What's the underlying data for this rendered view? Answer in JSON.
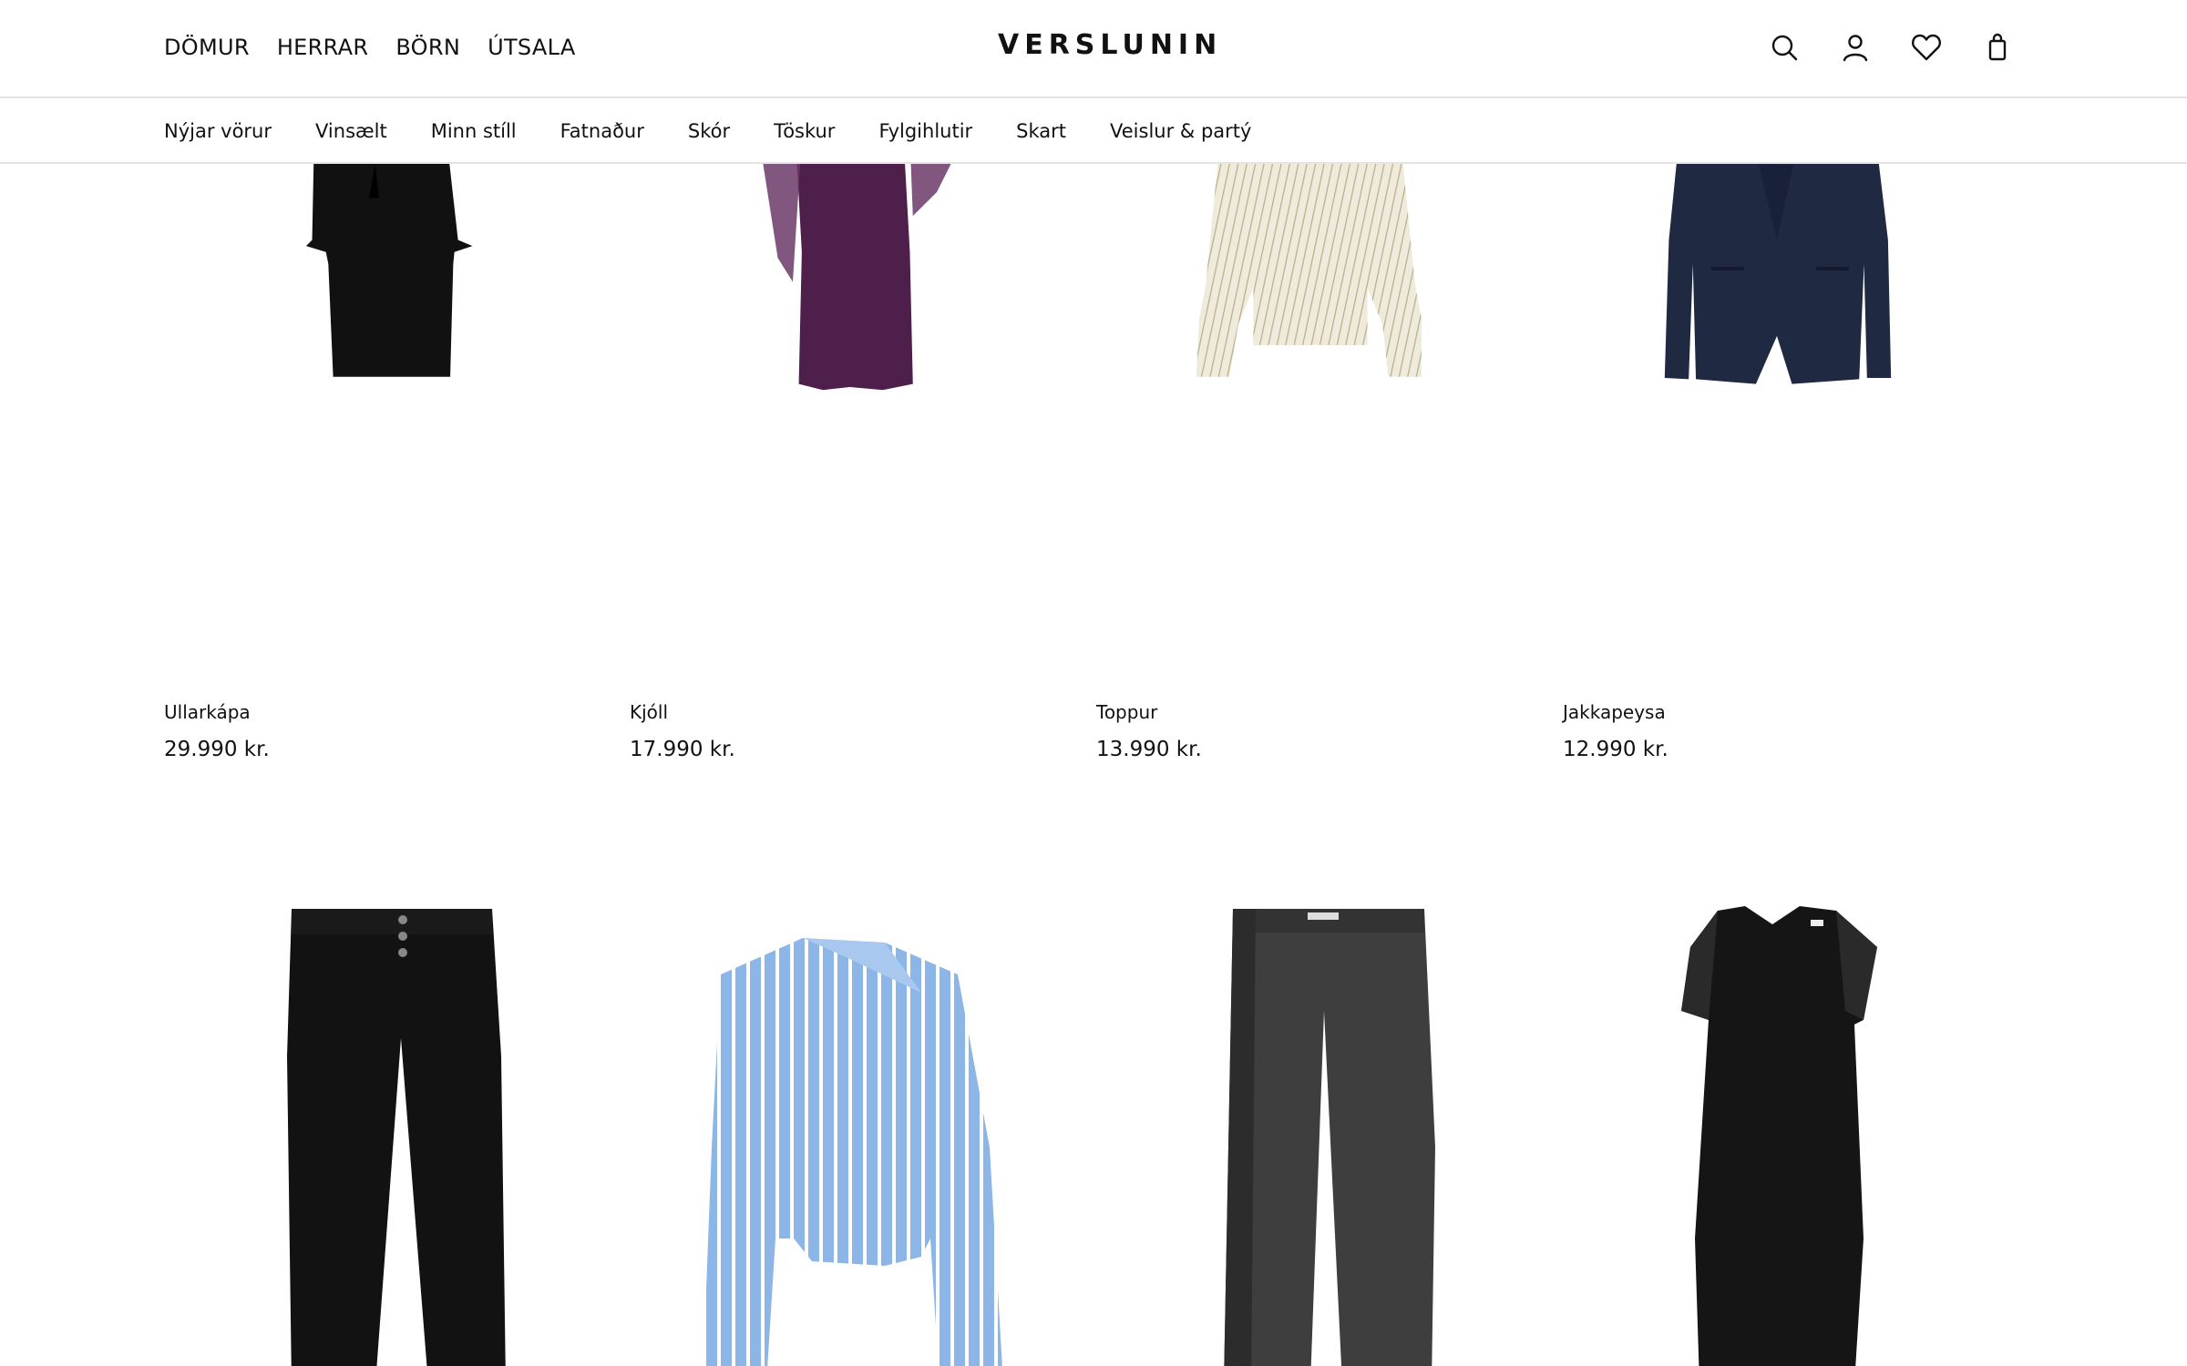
{
  "header": {
    "logo": "VERSLUNIN",
    "main_nav": [
      {
        "label": "DÖMUR"
      },
      {
        "label": "HERRAR"
      },
      {
        "label": "BÖRN"
      },
      {
        "label": "ÚTSALA"
      }
    ],
    "icons": [
      "search-icon",
      "account-icon",
      "wishlist-heart-icon",
      "shopping-bag-icon"
    ]
  },
  "sub_nav": [
    {
      "label": "Nýjar vörur"
    },
    {
      "label": "Vinsælt"
    },
    {
      "label": "Minn stíll"
    },
    {
      "label": "Fatnaður"
    },
    {
      "label": "Skór"
    },
    {
      "label": "Töskur"
    },
    {
      "label": "Fylgihlutir"
    },
    {
      "label": "Skart"
    },
    {
      "label": "Veislur & partý"
    }
  ],
  "products": [
    {
      "name": "Ullarkápa",
      "price": "29.990 kr.",
      "image": "black-wool-coat",
      "color": "#111111"
    },
    {
      "name": "Kjóll",
      "price": "17.990 kr.",
      "image": "purple-dress",
      "color": "#5a2a55"
    },
    {
      "name": "Toppur",
      "price": "13.990 kr.",
      "image": "striped-cream-blouse",
      "color": "#eee9d3"
    },
    {
      "name": "Jakkapeysa",
      "price": "12.990 kr.",
      "image": "navy-blazer",
      "color": "#1f2840"
    },
    {
      "name": "",
      "price": "",
      "image": "black-jeans",
      "color": "#121212"
    },
    {
      "name": "",
      "price": "",
      "image": "blue-striped-shirt",
      "color": "#8ab4e6"
    },
    {
      "name": "",
      "price": "",
      "image": "grey-trousers",
      "color": "#3f3f3f"
    },
    {
      "name": "",
      "price": "",
      "image": "black-satin-dress",
      "color": "#141414"
    }
  ]
}
